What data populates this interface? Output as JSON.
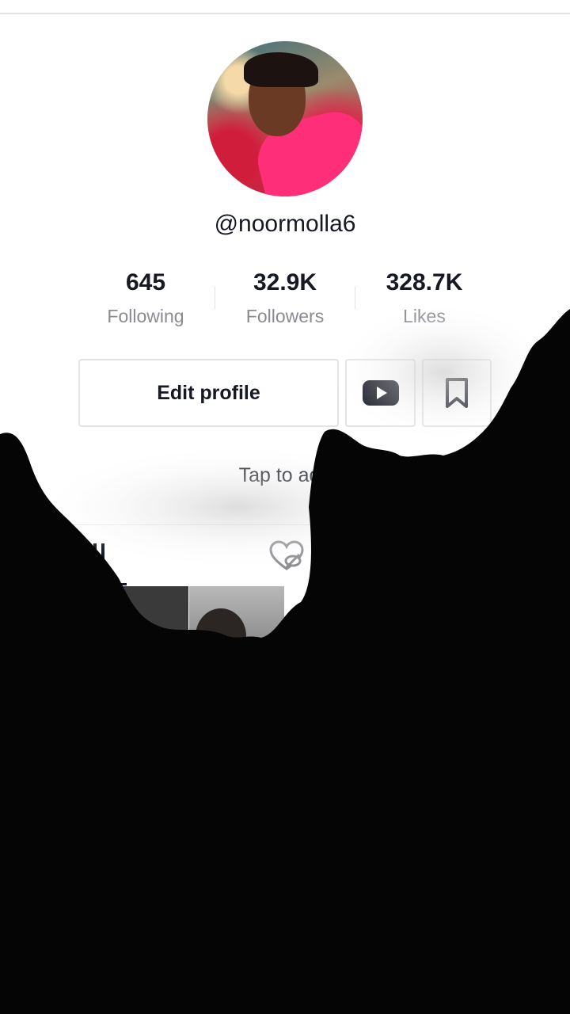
{
  "profile": {
    "username": "@noormolla6",
    "bio_placeholder": "Tap to add"
  },
  "stats": [
    {
      "value": "645",
      "label": "Following"
    },
    {
      "value": "32.9K",
      "label": "Followers"
    },
    {
      "value": "328.7K",
      "label": "Likes"
    }
  ],
  "actions": {
    "edit_profile": "Edit profile"
  },
  "icons": {
    "youtube": "youtube-icon",
    "bookmark": "bookmark-icon",
    "grid": "grid-icon",
    "liked": "heart-hidden-icon"
  },
  "colors": {
    "text": "#161823",
    "muted": "#8a8b91",
    "border": "#e3e3e4",
    "overlay": "#050505"
  }
}
